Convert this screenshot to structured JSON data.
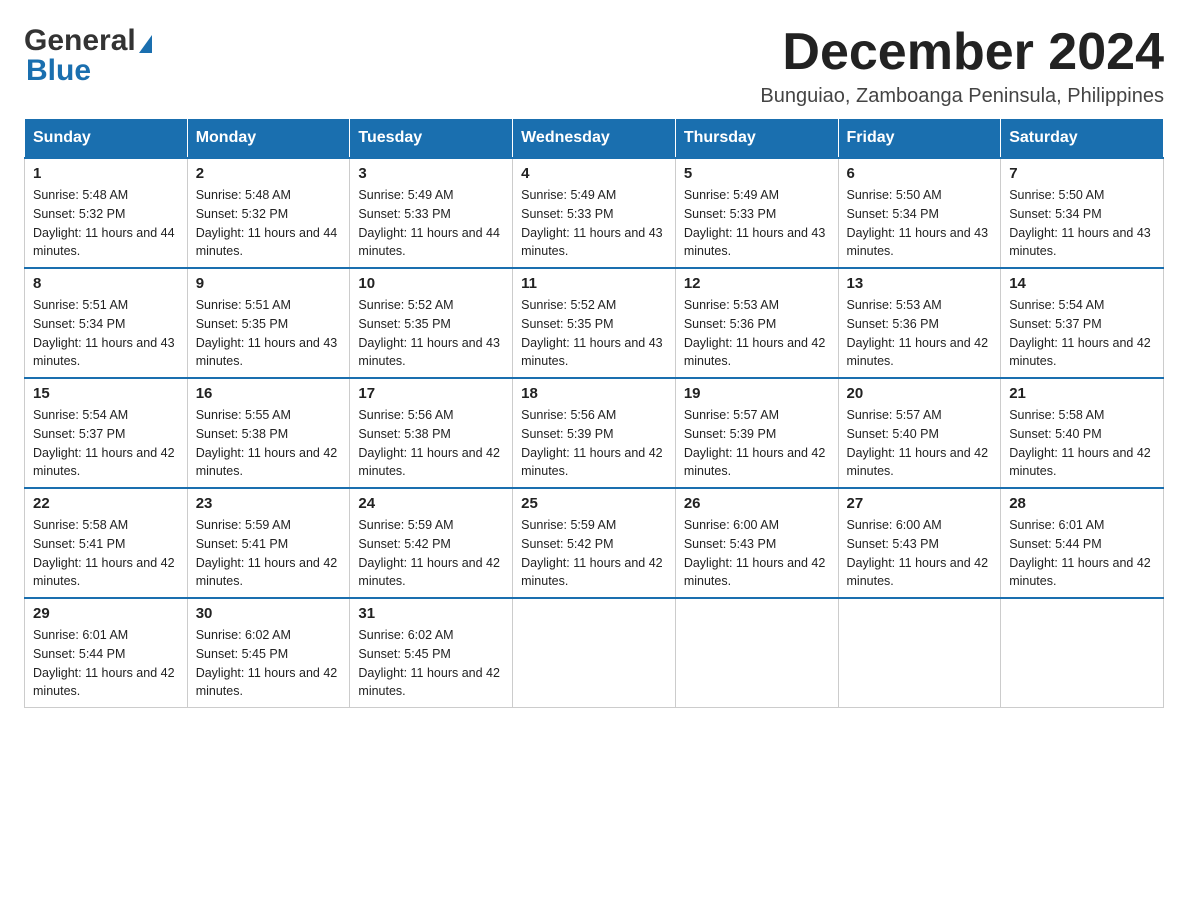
{
  "logo": {
    "line1": "General",
    "line2": "Blue",
    "arrow": true
  },
  "header": {
    "month_title": "December 2024",
    "location": "Bunguiao, Zamboanga Peninsula, Philippines"
  },
  "weekdays": [
    "Sunday",
    "Monday",
    "Tuesday",
    "Wednesday",
    "Thursday",
    "Friday",
    "Saturday"
  ],
  "weeks": [
    [
      {
        "day": "1",
        "sunrise": "5:48 AM",
        "sunset": "5:32 PM",
        "daylight": "11 hours and 44 minutes."
      },
      {
        "day": "2",
        "sunrise": "5:48 AM",
        "sunset": "5:32 PM",
        "daylight": "11 hours and 44 minutes."
      },
      {
        "day": "3",
        "sunrise": "5:49 AM",
        "sunset": "5:33 PM",
        "daylight": "11 hours and 44 minutes."
      },
      {
        "day": "4",
        "sunrise": "5:49 AM",
        "sunset": "5:33 PM",
        "daylight": "11 hours and 43 minutes."
      },
      {
        "day": "5",
        "sunrise": "5:49 AM",
        "sunset": "5:33 PM",
        "daylight": "11 hours and 43 minutes."
      },
      {
        "day": "6",
        "sunrise": "5:50 AM",
        "sunset": "5:34 PM",
        "daylight": "11 hours and 43 minutes."
      },
      {
        "day": "7",
        "sunrise": "5:50 AM",
        "sunset": "5:34 PM",
        "daylight": "11 hours and 43 minutes."
      }
    ],
    [
      {
        "day": "8",
        "sunrise": "5:51 AM",
        "sunset": "5:34 PM",
        "daylight": "11 hours and 43 minutes."
      },
      {
        "day": "9",
        "sunrise": "5:51 AM",
        "sunset": "5:35 PM",
        "daylight": "11 hours and 43 minutes."
      },
      {
        "day": "10",
        "sunrise": "5:52 AM",
        "sunset": "5:35 PM",
        "daylight": "11 hours and 43 minutes."
      },
      {
        "day": "11",
        "sunrise": "5:52 AM",
        "sunset": "5:35 PM",
        "daylight": "11 hours and 43 minutes."
      },
      {
        "day": "12",
        "sunrise": "5:53 AM",
        "sunset": "5:36 PM",
        "daylight": "11 hours and 42 minutes."
      },
      {
        "day": "13",
        "sunrise": "5:53 AM",
        "sunset": "5:36 PM",
        "daylight": "11 hours and 42 minutes."
      },
      {
        "day": "14",
        "sunrise": "5:54 AM",
        "sunset": "5:37 PM",
        "daylight": "11 hours and 42 minutes."
      }
    ],
    [
      {
        "day": "15",
        "sunrise": "5:54 AM",
        "sunset": "5:37 PM",
        "daylight": "11 hours and 42 minutes."
      },
      {
        "day": "16",
        "sunrise": "5:55 AM",
        "sunset": "5:38 PM",
        "daylight": "11 hours and 42 minutes."
      },
      {
        "day": "17",
        "sunrise": "5:56 AM",
        "sunset": "5:38 PM",
        "daylight": "11 hours and 42 minutes."
      },
      {
        "day": "18",
        "sunrise": "5:56 AM",
        "sunset": "5:39 PM",
        "daylight": "11 hours and 42 minutes."
      },
      {
        "day": "19",
        "sunrise": "5:57 AM",
        "sunset": "5:39 PM",
        "daylight": "11 hours and 42 minutes."
      },
      {
        "day": "20",
        "sunrise": "5:57 AM",
        "sunset": "5:40 PM",
        "daylight": "11 hours and 42 minutes."
      },
      {
        "day": "21",
        "sunrise": "5:58 AM",
        "sunset": "5:40 PM",
        "daylight": "11 hours and 42 minutes."
      }
    ],
    [
      {
        "day": "22",
        "sunrise": "5:58 AM",
        "sunset": "5:41 PM",
        "daylight": "11 hours and 42 minutes."
      },
      {
        "day": "23",
        "sunrise": "5:59 AM",
        "sunset": "5:41 PM",
        "daylight": "11 hours and 42 minutes."
      },
      {
        "day": "24",
        "sunrise": "5:59 AM",
        "sunset": "5:42 PM",
        "daylight": "11 hours and 42 minutes."
      },
      {
        "day": "25",
        "sunrise": "5:59 AM",
        "sunset": "5:42 PM",
        "daylight": "11 hours and 42 minutes."
      },
      {
        "day": "26",
        "sunrise": "6:00 AM",
        "sunset": "5:43 PM",
        "daylight": "11 hours and 42 minutes."
      },
      {
        "day": "27",
        "sunrise": "6:00 AM",
        "sunset": "5:43 PM",
        "daylight": "11 hours and 42 minutes."
      },
      {
        "day": "28",
        "sunrise": "6:01 AM",
        "sunset": "5:44 PM",
        "daylight": "11 hours and 42 minutes."
      }
    ],
    [
      {
        "day": "29",
        "sunrise": "6:01 AM",
        "sunset": "5:44 PM",
        "daylight": "11 hours and 42 minutes."
      },
      {
        "day": "30",
        "sunrise": "6:02 AM",
        "sunset": "5:45 PM",
        "daylight": "11 hours and 42 minutes."
      },
      {
        "day": "31",
        "sunrise": "6:02 AM",
        "sunset": "5:45 PM",
        "daylight": "11 hours and 42 minutes."
      },
      null,
      null,
      null,
      null
    ]
  ]
}
